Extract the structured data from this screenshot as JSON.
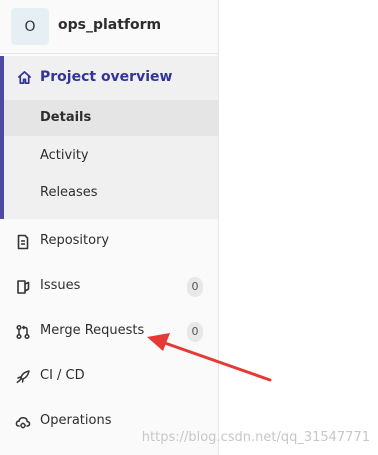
{
  "project": {
    "avatar_letter": "O",
    "name": "ops_platform"
  },
  "nav": {
    "project_overview": {
      "label": "Project overview",
      "icon": "home-icon",
      "subitems": [
        {
          "label": "Details",
          "active": true
        },
        {
          "label": "Activity",
          "active": false
        },
        {
          "label": "Releases",
          "active": false
        }
      ]
    },
    "items": [
      {
        "label": "Repository",
        "icon": "document-icon"
      },
      {
        "label": "Issues",
        "icon": "issues-icon",
        "count": "0"
      },
      {
        "label": "Merge Requests",
        "icon": "merge-request-icon",
        "count": "0"
      },
      {
        "label": "CI / CD",
        "icon": "rocket-icon"
      },
      {
        "label": "Operations",
        "icon": "cloud-gear-icon"
      }
    ]
  },
  "annotation": {
    "arrow_color": "#e53935",
    "target": "Merge Requests"
  },
  "watermark": "https://blog.csdn.net/qq_31547771",
  "colors": {
    "accent": "#4b4ba3",
    "active_text": "#333399",
    "sidebar_bg": "#fafafa",
    "active_bg": "#f0f0f0"
  }
}
